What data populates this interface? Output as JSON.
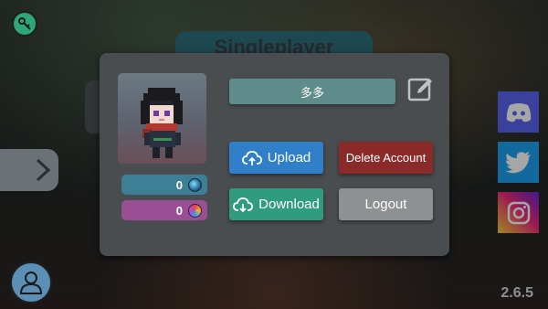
{
  "background": {
    "title_button_label": "Singleplayer"
  },
  "profile": {
    "username": "多多",
    "currency_1": "0",
    "currency_2": "0"
  },
  "buttons": {
    "upload": "Upload",
    "download": "Download",
    "delete_account": "Delete Account",
    "logout": "Logout"
  },
  "version": "2.6.5",
  "icons": {
    "top_left": "key-settings-icon",
    "edit": "edit-icon",
    "upload": "cloud-upload-icon",
    "download": "cloud-download-icon",
    "left_arrow": "chevron-right-icon",
    "discord": "discord-icon",
    "twitter": "twitter-icon",
    "instagram": "instagram-icon",
    "avatar": "user-icon"
  },
  "colors": {
    "panel": "#494d50",
    "upload": "#2f80c9",
    "download": "#2f9b7f",
    "delete": "#8a2b2a",
    "logout": "#8f9091",
    "name_field": "#5e8c8a"
  }
}
